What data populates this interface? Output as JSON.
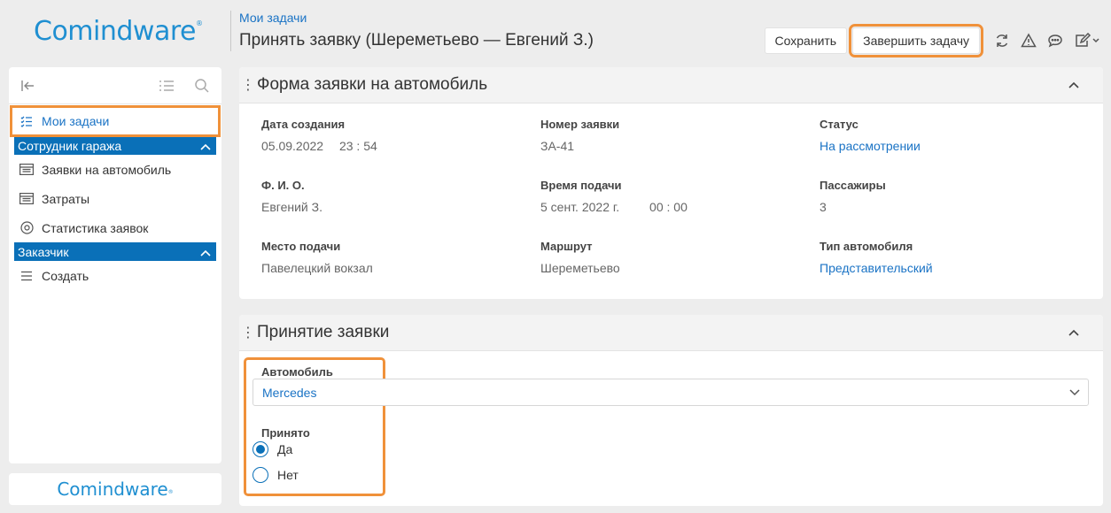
{
  "app": {
    "logo_text": "Comindware",
    "logo_mark": "®"
  },
  "header": {
    "breadcrumb": "Мои задачи",
    "title": "Принять заявку (Шереметьево — Евгений З.)",
    "save_label": "Сохранить",
    "complete_label": "Завершить задачу"
  },
  "sidebar": {
    "my_tasks": "Мои задачи",
    "groups": [
      {
        "label": "Сотрудник гаража",
        "items": [
          "Заявки на автомобиль",
          "Затраты",
          "Статистика заявок"
        ]
      },
      {
        "label": "Заказчик",
        "items": [
          "Создать"
        ]
      }
    ]
  },
  "form_panel": {
    "title": "Форма заявки на автомобиль",
    "fields": {
      "created_label": "Дата создания",
      "created_date": "05.09.2022",
      "created_time": "23 : 54",
      "number_label": "Номер заявки",
      "number_value": "ЗА-41",
      "status_label": "Статус",
      "status_value": "На рассмотрении",
      "fio_label": "Ф. И. О.",
      "fio_value": "Евгений З.",
      "pickup_time_label": "Время подачи",
      "pickup_date": "5 сент. 2022 г.",
      "pickup_time": "00 : 00",
      "passengers_label": "Пассажиры",
      "passengers_value": "3",
      "place_label": "Место подачи",
      "place_value": "Павелецкий вокзал",
      "route_label": "Маршрут",
      "route_value": "Шереметьево",
      "car_type_label": "Тип автомобиля",
      "car_type_value": "Представительский"
    }
  },
  "accept_panel": {
    "title": "Принятие заявки",
    "car_label": "Автомобиль",
    "car_value": "Mercedes",
    "accepted_label": "Принято",
    "option_yes": "Да",
    "option_no": "Нет",
    "selected": "Да"
  },
  "colors": {
    "accent": "#0a70b8",
    "highlight": "#f0913a",
    "link": "#1a73c5"
  }
}
